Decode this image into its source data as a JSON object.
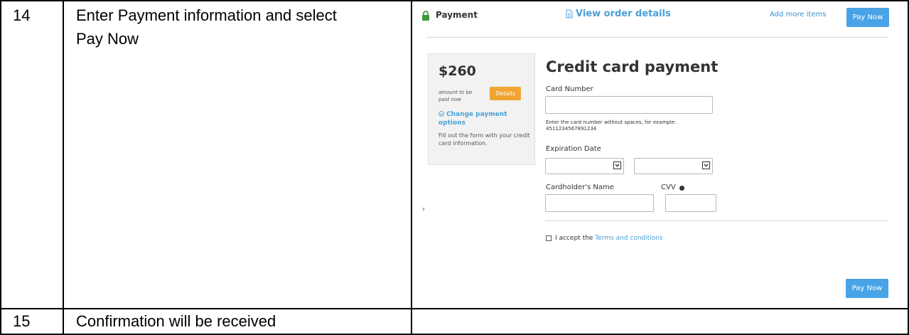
{
  "rows": [
    {
      "step": "14",
      "instruction_line1": "Enter Payment information and select",
      "instruction_line2": "Pay Now"
    },
    {
      "step": "15",
      "instruction": "Confirmation will be received"
    }
  ],
  "payment_ui": {
    "header": {
      "payment_label": "Payment",
      "view_details_label": "View order details",
      "add_items_link": "Add more items",
      "pay_now_label": "Pay Now"
    },
    "summary": {
      "amount": "$260",
      "amount_note": "amount to be paid now",
      "details_button": "Details",
      "change_link": "Change payment options",
      "help_text": "Fill out the form with your credit card information."
    },
    "form": {
      "title": "Credit card payment",
      "card_number_label": "Card Number",
      "card_number_value": "",
      "card_hint": "Enter the card number without spaces, for example: 4511234567891234",
      "expiration_label": "Expiration Date",
      "exp_month_value": "",
      "exp_year_value": "",
      "cardholder_label": "Cardholder's Name",
      "cardholder_value": "",
      "cvv_label": "CVV",
      "cvv_value": "",
      "accept_prefix": "I accept the",
      "terms_link": "Terms and conditions",
      "pay_now_label": "Pay Now"
    },
    "colors": {
      "accent_blue": "#4aa3e6",
      "link_blue": "#4a9fd8",
      "details_orange": "#f0a431",
      "lock_green": "#3c9a3c"
    },
    "icons": [
      "lock-icon",
      "document-icon",
      "change-options-icon",
      "help-icon",
      "chevron-down-icon",
      "checkbox-icon"
    ]
  }
}
